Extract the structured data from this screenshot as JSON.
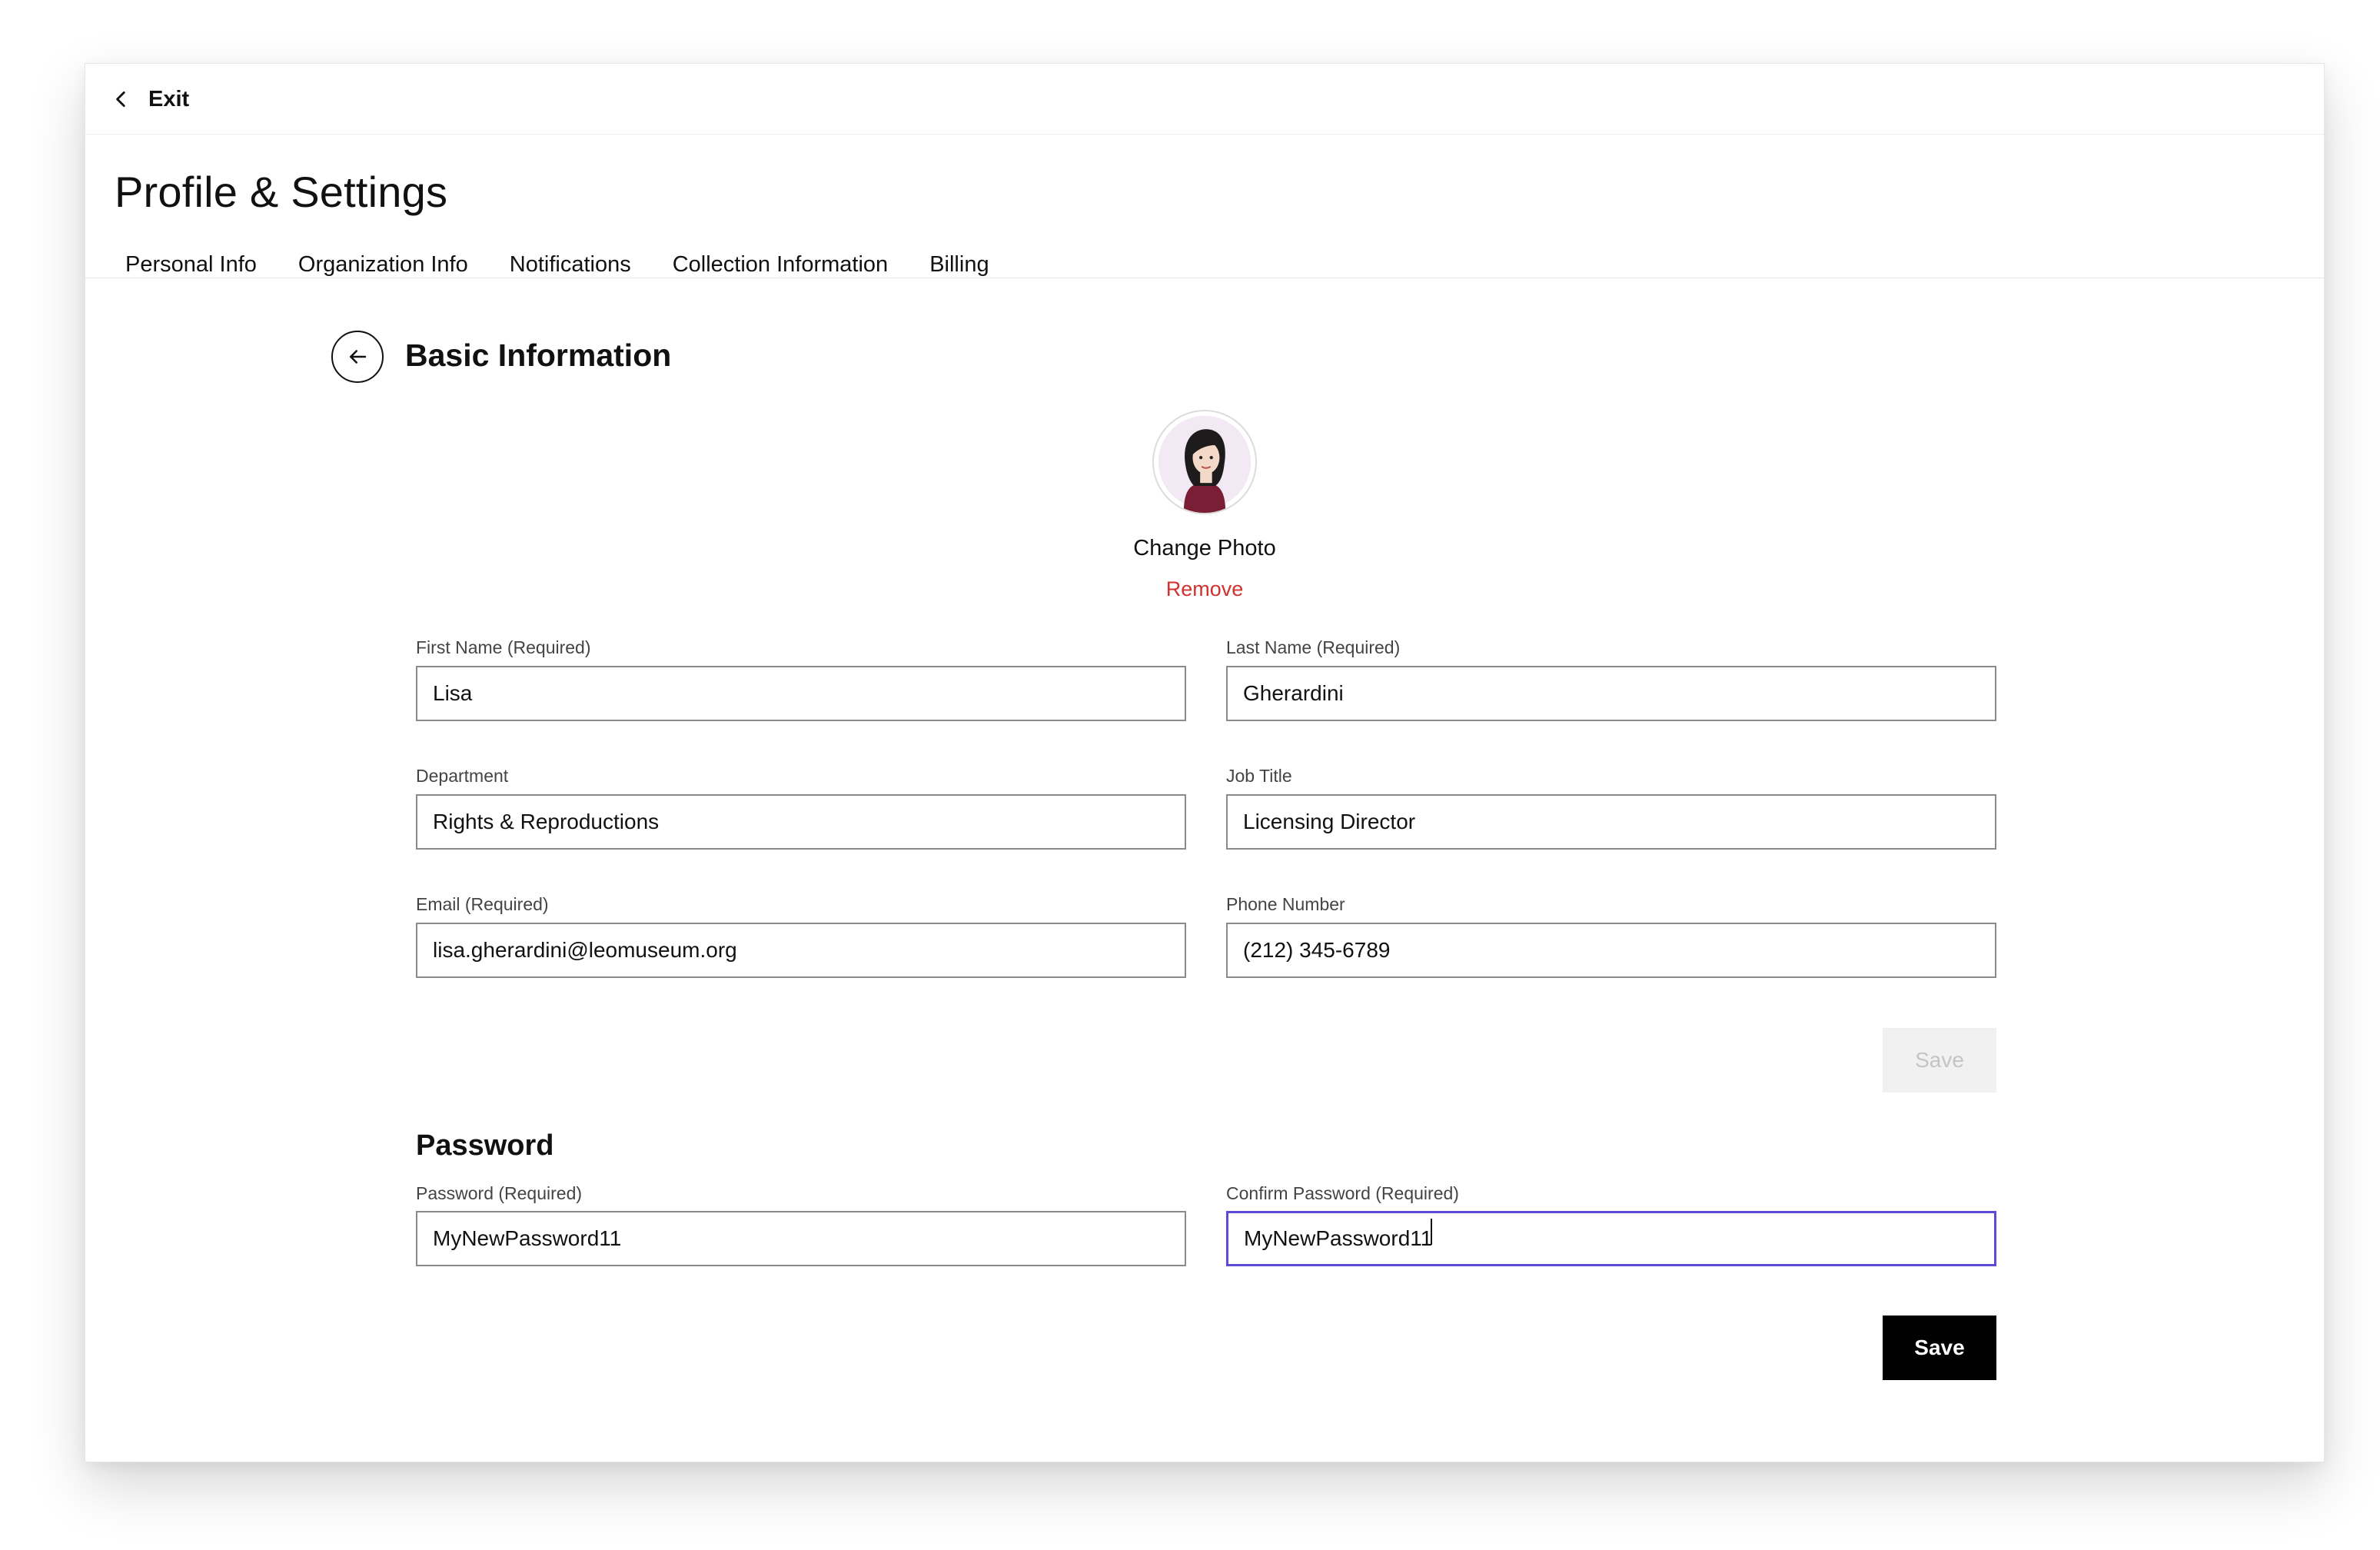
{
  "topbar": {
    "exit_label": "Exit"
  },
  "page": {
    "title": "Profile & Settings"
  },
  "tabs": [
    {
      "label": "Personal Info"
    },
    {
      "label": "Organization Info"
    },
    {
      "label": "Notifications"
    },
    {
      "label": "Collection Information"
    },
    {
      "label": "Billing"
    }
  ],
  "section": {
    "title": "Basic Information"
  },
  "photo": {
    "change_label": "Change Photo",
    "remove_label": "Remove"
  },
  "fields": {
    "first_name": {
      "label": "First Name (Required)",
      "value": "Lisa"
    },
    "last_name": {
      "label": "Last Name (Required)",
      "value": "Gherardini"
    },
    "department": {
      "label": "Department",
      "value": "Rights & Reproductions"
    },
    "job_title": {
      "label": "Job Title",
      "value": "Licensing Director"
    },
    "email": {
      "label": "Email (Required)",
      "value": "lisa.gherardini@leomuseum.org"
    },
    "phone": {
      "label": "Phone Number",
      "value": "(212) 345-6789"
    }
  },
  "basic_save_label": "Save",
  "password": {
    "title": "Password",
    "password": {
      "label": "Password (Required)",
      "value": "MyNewPassword11"
    },
    "confirm": {
      "label": "Confirm Password (Required)",
      "value": "MyNewPassword11"
    },
    "save_label": "Save"
  },
  "colors": {
    "remove": "#d0322d",
    "focus": "#5b4bd6",
    "primary": "#000000"
  }
}
